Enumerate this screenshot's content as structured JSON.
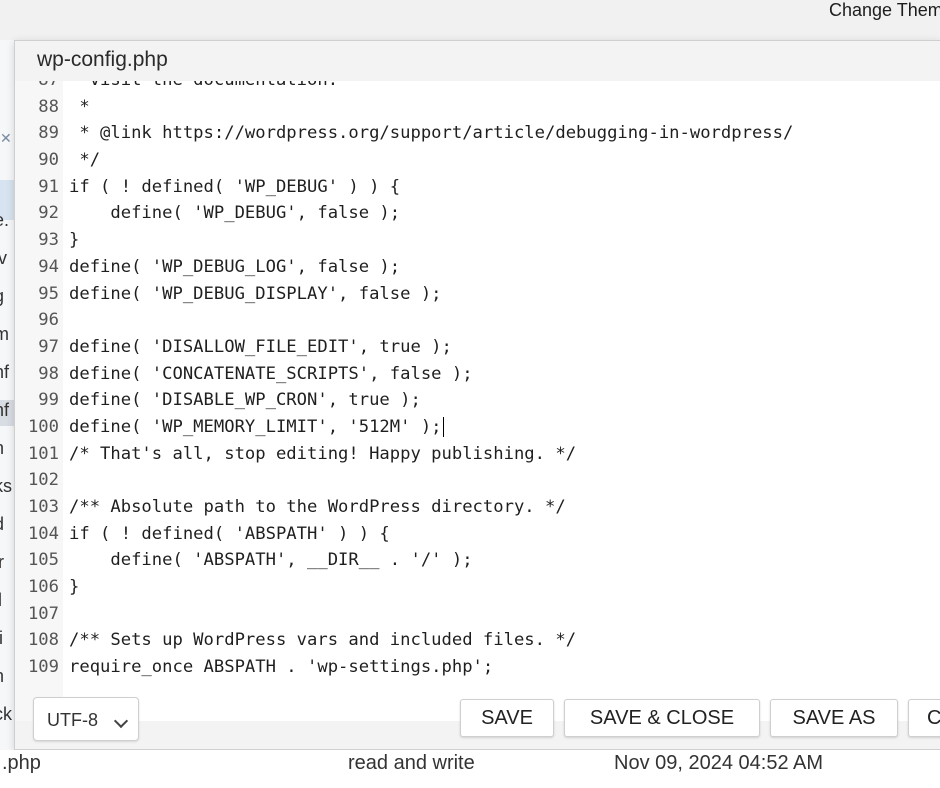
{
  "topbar": {
    "change_theme": "Change Them"
  },
  "background_list": {
    "rows": [
      "e.",
      "iv",
      "g",
      "m",
      "nf",
      "nf",
      "n",
      "ks",
      "d",
      "ir",
      "il",
      "ti",
      "n",
      "ck"
    ],
    "bottom_row": {
      "name": ".php",
      "permissions": "read and write",
      "modified": "Nov 09, 2024 04:52 AM"
    }
  },
  "dialog": {
    "title": "wp-config.php",
    "editor": {
      "lines": [
        {
          "num": "87",
          "code": "  visit the documentation."
        },
        {
          "num": "88",
          "code": " *"
        },
        {
          "num": "89",
          "code": " * @link https://wordpress.org/support/article/debugging-in-wordpress/"
        },
        {
          "num": "90",
          "code": " */"
        },
        {
          "num": "91",
          "code": "if ( ! defined( 'WP_DEBUG' ) ) {"
        },
        {
          "num": "92",
          "code": "    define( 'WP_DEBUG', false );"
        },
        {
          "num": "93",
          "code": "}"
        },
        {
          "num": "94",
          "code": "define( 'WP_DEBUG_LOG', false );"
        },
        {
          "num": "95",
          "code": "define( 'WP_DEBUG_DISPLAY', false );"
        },
        {
          "num": "96",
          "code": ""
        },
        {
          "num": "97",
          "code": "define( 'DISALLOW_FILE_EDIT', true );"
        },
        {
          "num": "98",
          "code": "define( 'CONCATENATE_SCRIPTS', false );"
        },
        {
          "num": "99",
          "code": "define( 'DISABLE_WP_CRON', true );"
        },
        {
          "num": "100",
          "code": "define( 'WP_MEMORY_LIMIT', '512M' );"
        },
        {
          "num": "101",
          "code": "/* That's all, stop editing! Happy publishing. */"
        },
        {
          "num": "102",
          "code": ""
        },
        {
          "num": "103",
          "code": "/** Absolute path to the WordPress directory. */"
        },
        {
          "num": "104",
          "code": "if ( ! defined( 'ABSPATH' ) ) {"
        },
        {
          "num": "105",
          "code": "    define( 'ABSPATH', __DIR__ . '/' );"
        },
        {
          "num": "106",
          "code": "}"
        },
        {
          "num": "107",
          "code": ""
        },
        {
          "num": "108",
          "code": "/** Sets up WordPress vars and included files. */"
        },
        {
          "num": "109",
          "code": "require_once ABSPATH . 'wp-settings.php';"
        }
      ],
      "cursor_line": "100"
    },
    "footer": {
      "encoding": "UTF-8",
      "save": "SAVE",
      "save_close": "SAVE & CLOSE",
      "save_as": "SAVE AS",
      "cancel_partial": "C"
    }
  }
}
